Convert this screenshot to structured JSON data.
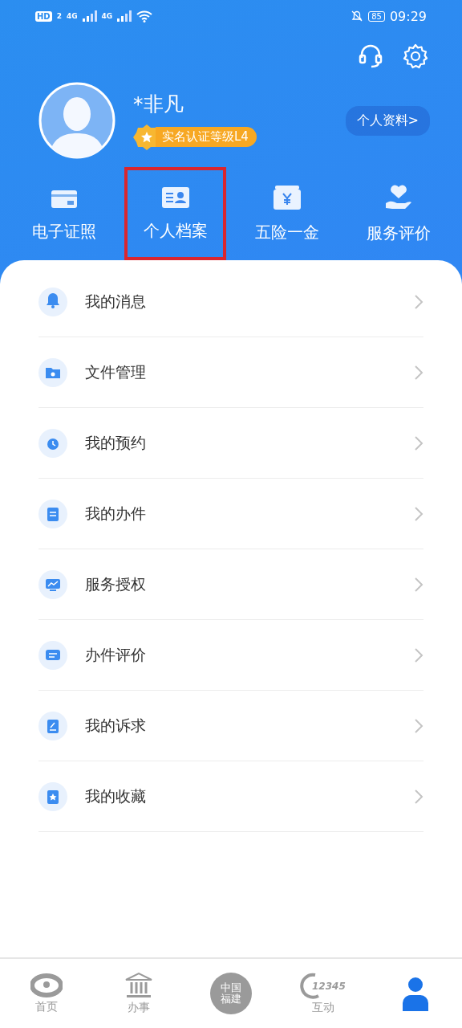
{
  "status_bar": {
    "hd": "HD",
    "sim": "2",
    "net1": "4G",
    "net2": "4G",
    "battery": "85",
    "time": "09:29"
  },
  "profile": {
    "name": "*非凡",
    "badge": "实名认证等级L4",
    "details_button": "个人资料>"
  },
  "shortcuts": [
    {
      "label": "电子证照",
      "kind": "card",
      "highlighted": false
    },
    {
      "label": "个人档案",
      "kind": "profile",
      "highlighted": true
    },
    {
      "label": "五险一金",
      "kind": "money",
      "highlighted": false
    },
    {
      "label": "服务评价",
      "kind": "heart",
      "highlighted": false
    }
  ],
  "menu": [
    {
      "label": "我的消息",
      "kind": "bell"
    },
    {
      "label": "文件管理",
      "kind": "folder"
    },
    {
      "label": "我的预约",
      "kind": "clock"
    },
    {
      "label": "我的办件",
      "kind": "doc"
    },
    {
      "label": "服务授权",
      "kind": "monitor"
    },
    {
      "label": "办件评价",
      "kind": "chat"
    },
    {
      "label": "我的诉求",
      "kind": "edit"
    },
    {
      "label": "我的收藏",
      "kind": "star"
    }
  ],
  "tab_bar": [
    {
      "label": "首页",
      "kind": "home",
      "selected": false
    },
    {
      "label": "办事",
      "kind": "bank",
      "selected": false
    },
    {
      "logo": "中国福建",
      "kind": "logo",
      "selected": false
    },
    {
      "label": "互动",
      "kind": "hotline",
      "logo": "12345",
      "selected": false
    },
    {
      "kind": "person",
      "selected": true
    }
  ]
}
